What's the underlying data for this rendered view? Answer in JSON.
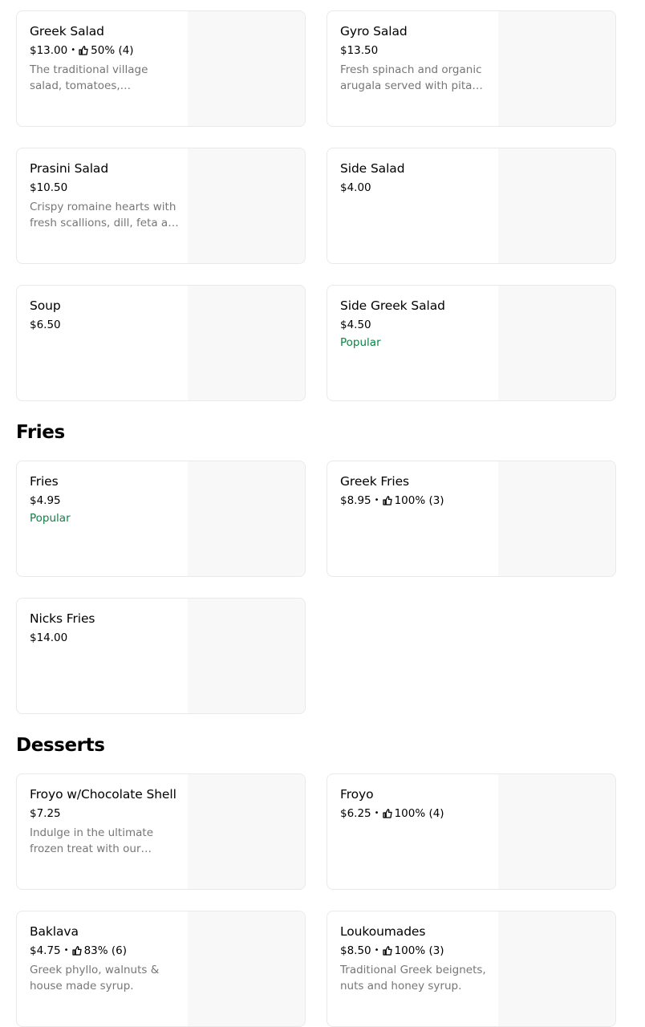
{
  "icon": "thumbs-up-icon",
  "colors": {
    "popular": "#0e8345",
    "description": "#767676",
    "image_placeholder": "#f8f8f8"
  },
  "salads": [
    {
      "name": "Greek Salad",
      "price": "$13.00",
      "rating": "50% (4)",
      "description": "The traditional village salad, tomatoes, cucumbers, red onions, peppers, olives and feta."
    },
    {
      "name": "Gyro Salad",
      "price": "$13.50",
      "description": "Fresh spinach and organic arugala served with pita chips and gyro meat."
    },
    {
      "name": "Prasini Salad",
      "price": "$10.50",
      "description": "Crispy romaine hearts with fresh scallions, dill, feta and lemon vinaigrette."
    },
    {
      "name": "Side Salad",
      "price": "$4.00"
    },
    {
      "name": "Soup",
      "price": "$6.50"
    },
    {
      "name": "Side Greek Salad",
      "price": "$4.50",
      "badge": "Popular"
    }
  ],
  "fries_section": {
    "title": "Fries"
  },
  "fries": [
    {
      "name": "Fries",
      "price": "$4.95",
      "badge": "Popular"
    },
    {
      "name": "Greek Fries",
      "price": "$8.95",
      "rating": "100% (3)"
    },
    {
      "name": "Nicks Fries",
      "price": "$14.00"
    }
  ],
  "desserts_section": {
    "title": "Desserts"
  },
  "desserts": [
    {
      "name": "Froyo w/Chocolate Shell",
      "price": "$7.25",
      "description": "Indulge in the ultimate frozen treat with our creamy froyo dipped in a chocolate shell."
    },
    {
      "name": "Froyo",
      "price": "$6.25",
      "rating": "100% (4)"
    },
    {
      "name": "Baklava",
      "price": "$4.75",
      "rating": "83% (6)",
      "description": "Greek phyllo, walnuts & house made syrup."
    },
    {
      "name": "Loukoumades",
      "price": "$8.50",
      "rating": "100% (3)",
      "description": "Traditional Greek beignets, nuts and honey syrup."
    }
  ]
}
